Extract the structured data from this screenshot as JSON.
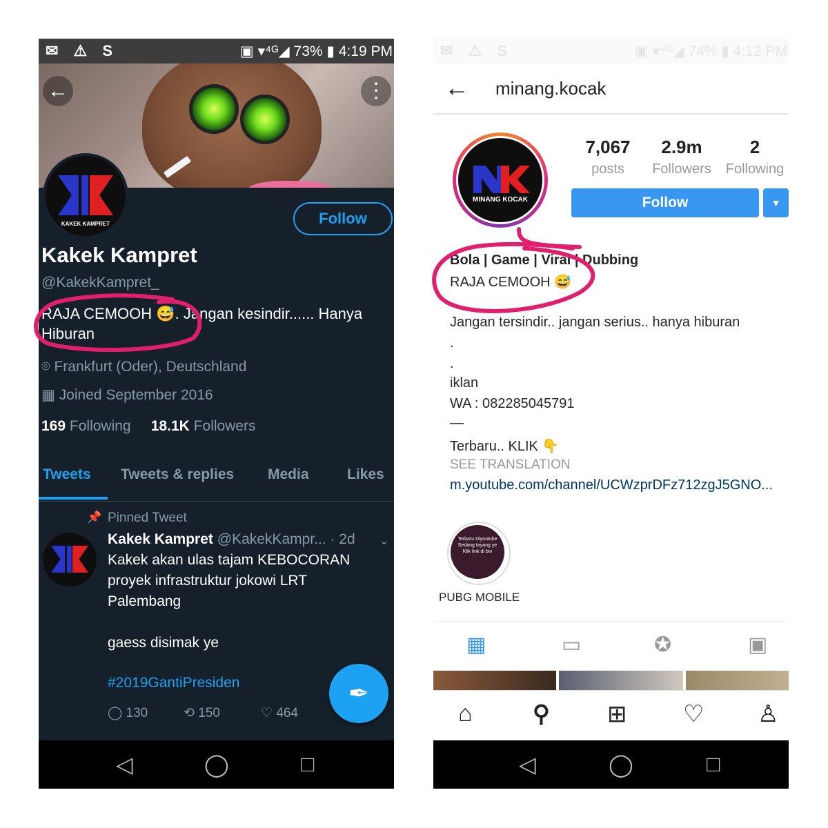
{
  "twitter": {
    "status": {
      "left_icons": "✉ ⚠ S",
      "right": "▣ ▾⁴ᴳ◢ 73% ▮ 4:19 PM"
    },
    "banner_buttons": {
      "back": "←",
      "more": "⋮"
    },
    "avatar_text": "KAKEK KAMPRET",
    "follow_label": "Follow",
    "name": "Kakek Kampret",
    "handle": "@KakekKampret_",
    "bio": "RAJA CEMOOH 😅. Jangan kesindir...... Hanya Hiburan",
    "location": "Frankfurt (Oder), Deutschland",
    "joined": "Joined September 2016",
    "following_count": "169",
    "following_label": "Following",
    "followers_count": "18.1K",
    "followers_label": "Followers",
    "tabs": [
      "Tweets",
      "Tweets & replies",
      "Media",
      "Likes"
    ],
    "pinned_label": "Pinned Tweet",
    "tweet": {
      "author": "Kakek Kampret",
      "handle": "@KakekKampr...",
      "age": "· 2d",
      "line1": "Kakek akan ulas tajam KEBOCORAN",
      "line2": "proyek infrastruktur jokowi LRT",
      "line3": "Palembang",
      "line4": "gaess disimak ye",
      "hashtag": "#2019GantiPresiden",
      "replies": "130",
      "retweets": "150",
      "likes": "464"
    },
    "icons": {
      "location": "location-pin-icon",
      "calendar": "calendar-icon",
      "pin": "pin-icon"
    },
    "colors": {
      "bg": "#15202b",
      "accent": "#1da1f2"
    }
  },
  "instagram": {
    "status": {
      "left_icons": "✉ ⚠ S",
      "right": "▣ ▾⁴ᴳ◢ 74% ▮ 4:12 PM"
    },
    "username": "minang.kocak",
    "avatar_text": "MINANG KOCAK",
    "posts_count": "7,067",
    "posts_label": "posts",
    "followers_count": "2.9m",
    "followers_label": "Followers",
    "following_count": "2",
    "following_label": "Following",
    "follow_label": "Follow",
    "bio_title": "Bola | Game | Viral | Dubbing",
    "bio_line2": "RAJA CEMOOH 😅",
    "bio_line3": "Jangan tersindir.. jangan serius.. hanya hiburan",
    "dot1": ".",
    "dot2": ".",
    "iklan": "iklan",
    "wa": "WA  : 082285045791",
    "dash": "—",
    "terbaru": "Terbaru.. KLIK 👇",
    "see_translation": "SEE TRANSLATION",
    "link": "m.youtube.com/channel/UCWzprDFz712zgJ5GNO...",
    "highlight_text": "Terbaru Diyoutube Sedang tayang ye Klik link di bio",
    "highlight_label": "PUBG MOBILE",
    "colors": {
      "accent": "#3897f0"
    }
  }
}
